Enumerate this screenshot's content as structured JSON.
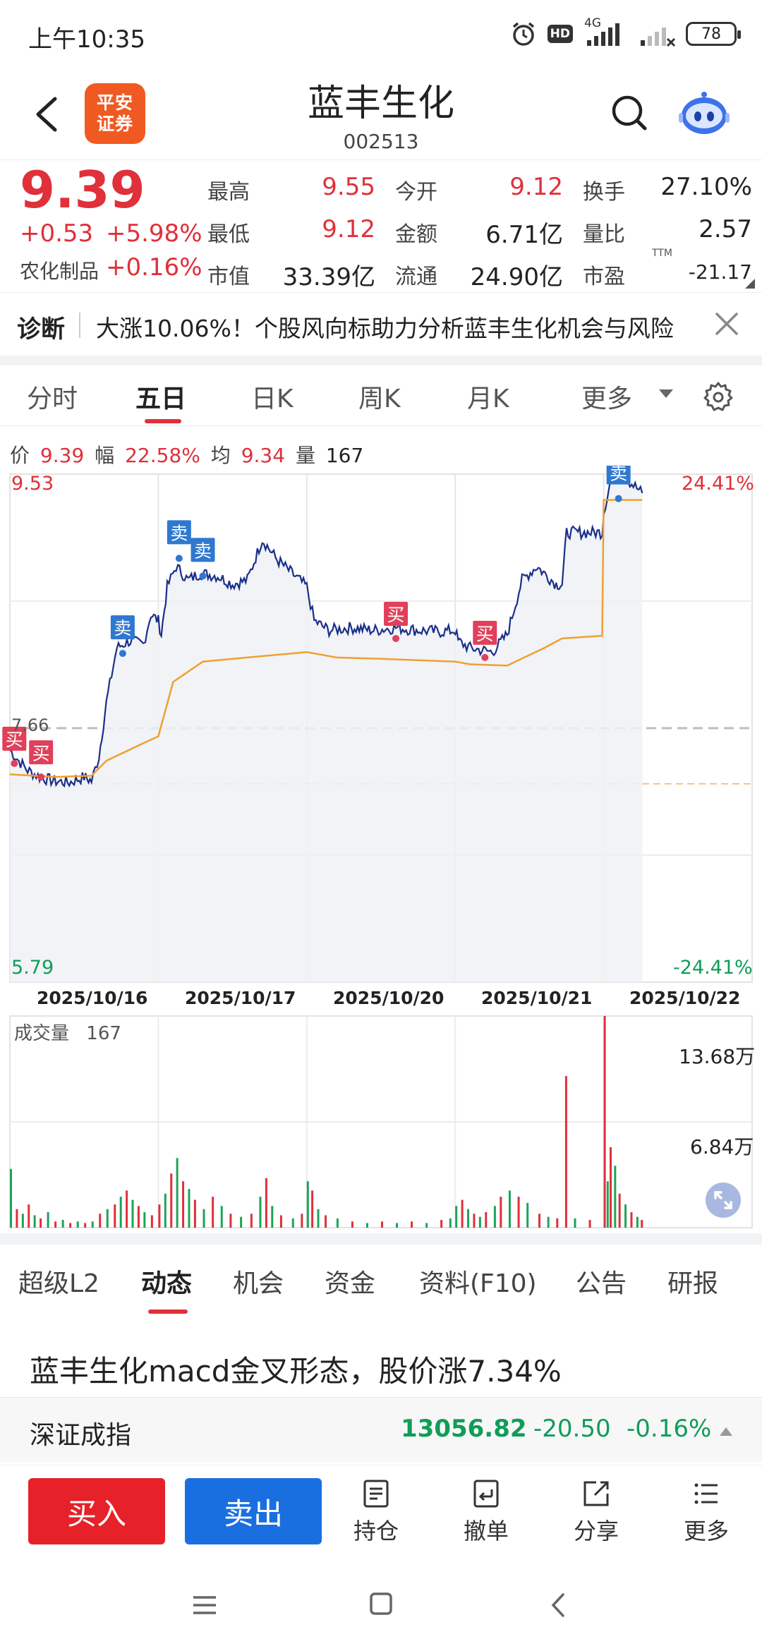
{
  "status": {
    "time": "上午10:35",
    "network": "4G",
    "hd": "HD",
    "battery": "78"
  },
  "header": {
    "logo_line1": "平安",
    "logo_line2": "证券",
    "stock_name": "蓝丰生化",
    "stock_code": "002513"
  },
  "quote": {
    "price": "9.39",
    "change": "+0.53",
    "change_pct": "+5.98%",
    "sector": "农化制品",
    "sector_pct": "+0.16%",
    "high_label": "最高",
    "high": "9.55",
    "low_label": "最低",
    "low": "9.12",
    "mcap_label": "市值",
    "mcap": "33.39亿",
    "open_label": "今开",
    "open": "9.12",
    "amount_label": "金额",
    "amount": "6.71亿",
    "float_label": "流通",
    "float": "24.90亿",
    "turnover_label": "换手",
    "turnover": "27.10%",
    "vol_ratio_label": "量比",
    "vol_ratio": "2.57",
    "pe_label": "市盈",
    "pe_ttm": "TTM",
    "pe": "-21.17"
  },
  "diagnosis": {
    "label": "诊断",
    "text": "大涨10.06%！个股风向标助力分析蓝丰生化机会与风险"
  },
  "period_tabs": [
    "分时",
    "五日",
    "日K",
    "周K",
    "月K",
    "更多"
  ],
  "info": {
    "price_label": "价",
    "price": "9.39",
    "amp_label": "幅",
    "amp": "22.58%",
    "avg_label": "均",
    "avg": "9.34",
    "vol_label": "量",
    "vol": "167"
  },
  "chart_data": {
    "type": "line",
    "title": "",
    "x": [
      "2025/10/16",
      "2025/10/17",
      "2025/10/20",
      "2025/10/21",
      "2025/10/22"
    ],
    "y_top": "9.53",
    "y_top_pct": "24.41%",
    "y_bottom": "5.79",
    "y_bottom_pct": "-24.41%",
    "ref_label": "7.66",
    "ylim": [
      5.79,
      9.53
    ],
    "reference_close": 7.66,
    "avg_line_ref": 7.25,
    "series": [
      {
        "color": "#1a2f8a",
        "values": [
          [
            0,
            7.5
          ],
          [
            0.06,
            7.42
          ],
          [
            0.12,
            7.35
          ],
          [
            0.2,
            7.3
          ],
          [
            0.3,
            7.27
          ],
          [
            0.4,
            7.26
          ],
          [
            0.5,
            7.3
          ],
          [
            0.55,
            7.27
          ],
          [
            0.6,
            7.45
          ],
          [
            0.65,
            7.85
          ],
          [
            0.72,
            8.25
          ],
          [
            0.8,
            8.3
          ],
          [
            0.9,
            8.28
          ],
          [
            0.95,
            8.5
          ],
          [
            1.0,
            8.45
          ],
          [
            1.02,
            8.35
          ],
          [
            1.06,
            8.7
          ],
          [
            1.12,
            8.85
          ],
          [
            1.2,
            8.75
          ],
          [
            1.28,
            8.8
          ],
          [
            1.4,
            8.78
          ],
          [
            1.5,
            8.72
          ],
          [
            1.6,
            8.75
          ],
          [
            1.7,
            9.05
          ],
          [
            1.8,
            8.9
          ],
          [
            1.9,
            8.8
          ],
          [
            2.0,
            8.7
          ],
          [
            2.05,
            8.45
          ],
          [
            2.15,
            8.38
          ],
          [
            2.3,
            8.4
          ],
          [
            2.45,
            8.38
          ],
          [
            2.6,
            8.4
          ],
          [
            2.75,
            8.38
          ],
          [
            2.9,
            8.37
          ],
          [
            3.0,
            8.38
          ],
          [
            3.02,
            8.3
          ],
          [
            3.1,
            8.25
          ],
          [
            3.25,
            8.22
          ],
          [
            3.35,
            8.35
          ],
          [
            3.45,
            8.75
          ],
          [
            3.55,
            8.85
          ],
          [
            3.68,
            8.72
          ],
          [
            3.72,
            8.72
          ],
          [
            3.75,
            9.1
          ],
          [
            3.99,
            9.1
          ],
          [
            4.0,
            9.25
          ],
          [
            4.05,
            9.5
          ],
          [
            4.12,
            9.53
          ],
          [
            4.2,
            9.45
          ],
          [
            4.26,
            9.39
          ]
        ]
      },
      {
        "color": "#f0a030",
        "values": [
          [
            0,
            7.32
          ],
          [
            0.3,
            7.3
          ],
          [
            0.55,
            7.31
          ],
          [
            0.65,
            7.42
          ],
          [
            0.9,
            7.55
          ],
          [
            1.0,
            7.6
          ],
          [
            1.1,
            8.0
          ],
          [
            1.3,
            8.15
          ],
          [
            1.6,
            8.18
          ],
          [
            2.0,
            8.22
          ],
          [
            2.2,
            8.18
          ],
          [
            2.5,
            8.17
          ],
          [
            3.0,
            8.15
          ],
          [
            3.1,
            8.13
          ],
          [
            3.35,
            8.12
          ],
          [
            3.6,
            8.25
          ],
          [
            3.72,
            8.32
          ],
          [
            3.99,
            8.34
          ],
          [
            4.0,
            9.34
          ],
          [
            4.26,
            9.34
          ]
        ]
      }
    ],
    "markers": [
      {
        "label": "买",
        "x": 0.03,
        "y": 7.4,
        "kind": "buy"
      },
      {
        "label": "买",
        "x": 0.21,
        "y": 7.3,
        "kind": "buy"
      },
      {
        "label": "卖",
        "x": 0.76,
        "y": 8.21,
        "kind": "sell"
      },
      {
        "label": "卖",
        "x": 1.14,
        "y": 8.91,
        "kind": "sell"
      },
      {
        "label": "卖",
        "x": 1.3,
        "y": 8.78,
        "kind": "sell"
      },
      {
        "label": "买",
        "x": 2.6,
        "y": 8.32,
        "kind": "buy"
      },
      {
        "label": "买",
        "x": 3.2,
        "y": 8.18,
        "kind": "buy"
      },
      {
        "label": "卖",
        "x": 4.1,
        "y": 9.35,
        "kind": "sell"
      }
    ]
  },
  "volume": {
    "title": "成交量",
    "current": "167",
    "max_label": "13.68万",
    "mid_label": "6.84万"
  },
  "volume_data": {
    "type": "bar",
    "ylim": [
      0,
      136800
    ],
    "values": [
      [
        0.0,
        38000,
        "g"
      ],
      [
        0.04,
        12000,
        "r"
      ],
      [
        0.08,
        9000,
        "g"
      ],
      [
        0.12,
        15000,
        "r"
      ],
      [
        0.16,
        8000,
        "g"
      ],
      [
        0.2,
        6000,
        "r"
      ],
      [
        0.25,
        10000,
        "g"
      ],
      [
        0.3,
        4000,
        "r"
      ],
      [
        0.35,
        5000,
        "g"
      ],
      [
        0.4,
        3000,
        "r"
      ],
      [
        0.45,
        4000,
        "g"
      ],
      [
        0.5,
        3000,
        "r"
      ],
      [
        0.55,
        4000,
        "g"
      ],
      [
        0.6,
        9000,
        "r"
      ],
      [
        0.65,
        12000,
        "g"
      ],
      [
        0.7,
        15000,
        "r"
      ],
      [
        0.74,
        20000,
        "g"
      ],
      [
        0.78,
        24000,
        "r"
      ],
      [
        0.82,
        18000,
        "g"
      ],
      [
        0.86,
        14000,
        "r"
      ],
      [
        0.9,
        10000,
        "g"
      ],
      [
        0.95,
        8000,
        "r"
      ],
      [
        1.0,
        15000,
        "r"
      ],
      [
        1.04,
        22000,
        "g"
      ],
      [
        1.08,
        35000,
        "r"
      ],
      [
        1.12,
        45000,
        "g"
      ],
      [
        1.16,
        30000,
        "r"
      ],
      [
        1.2,
        25000,
        "g"
      ],
      [
        1.24,
        18000,
        "r"
      ],
      [
        1.3,
        12000,
        "g"
      ],
      [
        1.36,
        20000,
        "r"
      ],
      [
        1.42,
        14000,
        "g"
      ],
      [
        1.48,
        9000,
        "r"
      ],
      [
        1.55,
        7000,
        "g"
      ],
      [
        1.62,
        9000,
        "r"
      ],
      [
        1.68,
        20000,
        "g"
      ],
      [
        1.72,
        32000,
        "r"
      ],
      [
        1.76,
        14000,
        "g"
      ],
      [
        1.82,
        8000,
        "r"
      ],
      [
        1.9,
        6000,
        "g"
      ],
      [
        1.96,
        9000,
        "r"
      ],
      [
        2.0,
        30000,
        "g"
      ],
      [
        2.03,
        24000,
        "r"
      ],
      [
        2.07,
        12000,
        "g"
      ],
      [
        2.12,
        8000,
        "r"
      ],
      [
        2.2,
        6000,
        "g"
      ],
      [
        2.3,
        4000,
        "r"
      ],
      [
        2.4,
        3000,
        "g"
      ],
      [
        2.5,
        4000,
        "r"
      ],
      [
        2.6,
        3000,
        "g"
      ],
      [
        2.7,
        4000,
        "r"
      ],
      [
        2.8,
        3000,
        "g"
      ],
      [
        2.9,
        5000,
        "r"
      ],
      [
        2.96,
        6000,
        "g"
      ],
      [
        3.0,
        14000,
        "g"
      ],
      [
        3.04,
        18000,
        "r"
      ],
      [
        3.08,
        12000,
        "g"
      ],
      [
        3.12,
        9000,
        "r"
      ],
      [
        3.16,
        7000,
        "g"
      ],
      [
        3.2,
        10000,
        "r"
      ],
      [
        3.26,
        14000,
        "g"
      ],
      [
        3.3,
        20000,
        "r"
      ],
      [
        3.36,
        24000,
        "g"
      ],
      [
        3.42,
        20000,
        "r"
      ],
      [
        3.48,
        16000,
        "g"
      ],
      [
        3.56,
        9000,
        "r"
      ],
      [
        3.62,
        7000,
        "g"
      ],
      [
        3.68,
        6000,
        "r"
      ],
      [
        3.74,
        98000,
        "r"
      ],
      [
        3.8,
        6000,
        "g"
      ],
      [
        3.9,
        5000,
        "r"
      ],
      [
        4.0,
        136800,
        "r"
      ],
      [
        4.02,
        30000,
        "g"
      ],
      [
        4.04,
        52000,
        "r"
      ],
      [
        4.07,
        40000,
        "g"
      ],
      [
        4.1,
        22000,
        "r"
      ],
      [
        4.14,
        15000,
        "g"
      ],
      [
        4.18,
        10000,
        "r"
      ],
      [
        4.22,
        7000,
        "g"
      ],
      [
        4.25,
        5000,
        "r"
      ]
    ]
  },
  "news_tabs": [
    "超级L2",
    "动态",
    "机会",
    "资金",
    "资料(F10)",
    "公告",
    "研报"
  ],
  "headline": "蓝丰生化macd金叉形态，股价涨7.34%",
  "index": {
    "name": "深证成指",
    "value": "13056.82",
    "change": "-20.50",
    "change_pct": "-0.16%"
  },
  "trade": {
    "buy": "买入",
    "sell": "卖出",
    "tools": [
      "持仓",
      "撤单",
      "分享",
      "更多"
    ]
  },
  "colors": {
    "up": "#e0303a",
    "down": "#0f9d58",
    "buy_btn": "#e62129",
    "sell_btn": "#1a6fe0",
    "price_line": "#1a2f8a",
    "avg_line": "#f0a030"
  }
}
